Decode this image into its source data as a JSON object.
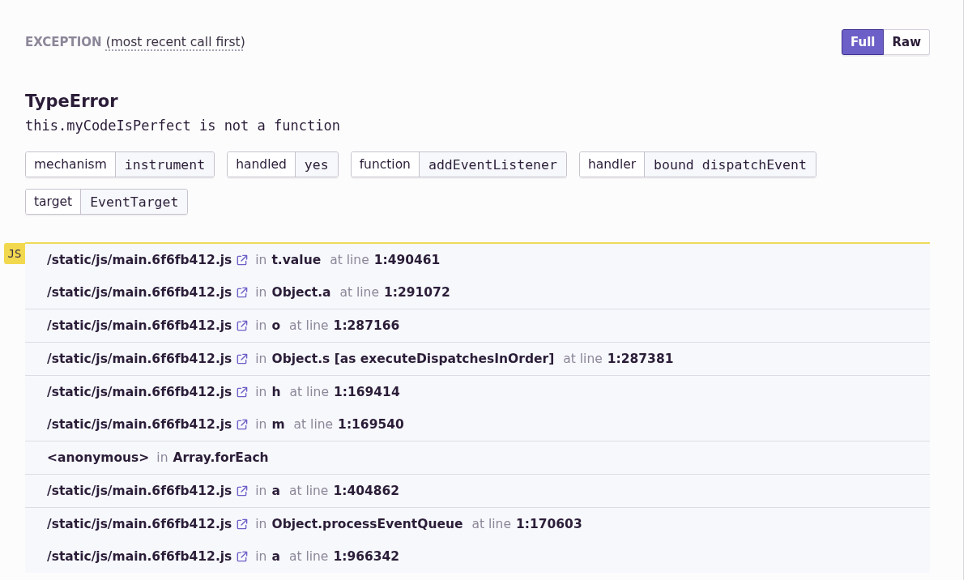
{
  "exception": {
    "heading": "EXCEPTION",
    "order_note": "(most recent call first)",
    "view_toggle": [
      {
        "label": "Full",
        "selected": true
      },
      {
        "label": "Raw",
        "selected": false
      }
    ]
  },
  "error": {
    "type": "TypeError",
    "message": "this.myCodeIsPerfect is not a function"
  },
  "tags": [
    {
      "key": "mechanism",
      "value": "instrument"
    },
    {
      "key": "handled",
      "value": "yes"
    },
    {
      "key": "function",
      "value": "addEventListener"
    },
    {
      "key": "handler",
      "value": "bound dispatchEvent"
    },
    {
      "key": "target",
      "value": "EventTarget"
    }
  ],
  "stacktrace": {
    "platform_badge": "JS",
    "frame_groups": [
      {
        "frames": [
          {
            "file": "/static/js/main.6f6fb412.js",
            "external_link": true,
            "in_label": "in",
            "function": "t.value",
            "line_label": "at line",
            "line": "1:490461"
          },
          {
            "file": "/static/js/main.6f6fb412.js",
            "external_link": true,
            "in_label": "in",
            "function": "Object.a",
            "line_label": "at line",
            "line": "1:291072"
          }
        ]
      },
      {
        "frames": [
          {
            "file": "/static/js/main.6f6fb412.js",
            "external_link": true,
            "in_label": "in",
            "function": "o",
            "line_label": "at line",
            "line": "1:287166"
          }
        ]
      },
      {
        "frames": [
          {
            "file": "/static/js/main.6f6fb412.js",
            "external_link": true,
            "in_label": "in",
            "function": "Object.s [as executeDispatchesInOrder]",
            "line_label": "at line",
            "line": "1:287381"
          }
        ]
      },
      {
        "frames": [
          {
            "file": "/static/js/main.6f6fb412.js",
            "external_link": true,
            "in_label": "in",
            "function": "h",
            "line_label": "at line",
            "line": "1:169414"
          },
          {
            "file": "/static/js/main.6f6fb412.js",
            "external_link": true,
            "in_label": "in",
            "function": "m",
            "line_label": "at line",
            "line": "1:169540"
          }
        ]
      },
      {
        "frames": [
          {
            "file": "<anonymous>",
            "external_link": false,
            "in_label": "in",
            "function": "Array.forEach"
          }
        ]
      },
      {
        "frames": [
          {
            "file": "/static/js/main.6f6fb412.js",
            "external_link": true,
            "in_label": "in",
            "function": "a",
            "line_label": "at line",
            "line": "1:404862"
          }
        ]
      },
      {
        "frames": [
          {
            "file": "/static/js/main.6f6fb412.js",
            "external_link": true,
            "in_label": "in",
            "function": "Object.processEventQueue",
            "line_label": "at line",
            "line": "1:170603"
          },
          {
            "file": "/static/js/main.6f6fb412.js",
            "external_link": true,
            "in_label": "in",
            "function": "a",
            "line_label": "at line",
            "line": "1:966342"
          }
        ]
      }
    ]
  }
}
